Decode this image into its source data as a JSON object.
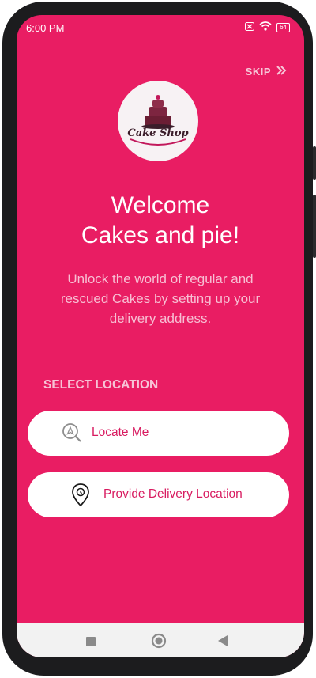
{
  "status_bar": {
    "time": "6:00 PM",
    "battery_level": "64"
  },
  "header": {
    "skip_label": "SKIP"
  },
  "logo": {
    "text": "Cake Shop"
  },
  "welcome": {
    "line1": "Welcome",
    "line2": "Cakes and pie!"
  },
  "subtitle": "Unlock the world of regular and rescued Cakes by setting up your delivery address.",
  "location": {
    "section_label": "SELECT LOCATION",
    "locate_me_label": "Locate Me",
    "provide_location_label": "Provide Delivery Location"
  },
  "colors": {
    "background": "#e91d63",
    "accent_text": "#d81b60",
    "button_bg": "#ffffff"
  },
  "icons": [
    "search-location-icon",
    "map-pin-icon",
    "skip-chevrons-icon",
    "wifi-icon",
    "battery-icon"
  ]
}
